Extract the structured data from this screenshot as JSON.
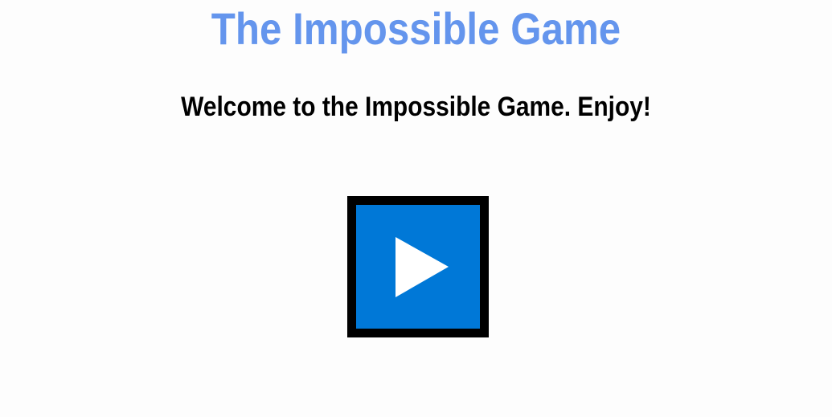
{
  "game": {
    "title": "The Impossible Game",
    "welcome_message": "Welcome to the Impossible Game. Enjoy!"
  },
  "play_button": {
    "icon": "play-icon",
    "background_color": "#0078d7",
    "border_color": "#000000"
  },
  "colors": {
    "title": "#6495ed",
    "text": "#000000",
    "background": "#fdfdfd"
  }
}
